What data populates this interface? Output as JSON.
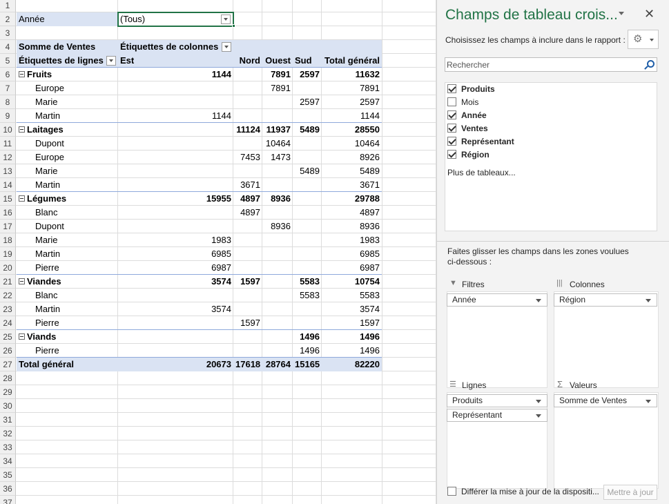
{
  "sheet": {
    "row_numbers": [
      "1",
      "2",
      "3",
      "4",
      "5",
      "6",
      "7",
      "8",
      "9",
      "10",
      "11",
      "12",
      "13",
      "14",
      "15",
      "16",
      "17",
      "18",
      "19",
      "20",
      "21",
      "22",
      "23",
      "24",
      "25",
      "26",
      "27",
      "28",
      "29",
      "30",
      "31",
      "32",
      "33",
      "34",
      "35",
      "36",
      "37"
    ],
    "filter_label": "Année",
    "filter_value": "(Tous)",
    "values_label": "Somme de Ventes",
    "col_labels": "Étiquettes de colonnes",
    "row_labels": "Étiquettes de lignes",
    "col_headers": [
      "Est",
      "Nord",
      "Ouest",
      "Sud",
      "Total général"
    ],
    "rows": [
      {
        "label": "Fruits",
        "level": 0,
        "vals": [
          "1144",
          "",
          "7891",
          "2597",
          "11632"
        ]
      },
      {
        "label": "Europe",
        "level": 1,
        "vals": [
          "",
          "",
          "7891",
          "",
          "7891"
        ]
      },
      {
        "label": "Marie",
        "level": 1,
        "vals": [
          "",
          "",
          "",
          "2597",
          "2597"
        ]
      },
      {
        "label": "Martin",
        "level": 1,
        "vals": [
          "1144",
          "",
          "",
          "",
          "1144"
        ]
      },
      {
        "label": "Laitages",
        "level": 0,
        "vals": [
          "",
          "11124",
          "11937",
          "5489",
          "28550"
        ]
      },
      {
        "label": "Dupont",
        "level": 1,
        "vals": [
          "",
          "",
          "10464",
          "",
          "10464"
        ]
      },
      {
        "label": "Europe",
        "level": 1,
        "vals": [
          "",
          "7453",
          "1473",
          "",
          "8926"
        ]
      },
      {
        "label": "Marie",
        "level": 1,
        "vals": [
          "",
          "",
          "",
          "5489",
          "5489"
        ]
      },
      {
        "label": "Martin",
        "level": 1,
        "vals": [
          "",
          "3671",
          "",
          "",
          "3671"
        ]
      },
      {
        "label": "Légumes",
        "level": 0,
        "vals": [
          "15955",
          "4897",
          "8936",
          "",
          "29788"
        ]
      },
      {
        "label": "Blanc",
        "level": 1,
        "vals": [
          "",
          "4897",
          "",
          "",
          "4897"
        ]
      },
      {
        "label": "Dupont",
        "level": 1,
        "vals": [
          "",
          "",
          "8936",
          "",
          "8936"
        ]
      },
      {
        "label": "Marie",
        "level": 1,
        "vals": [
          "1983",
          "",
          "",
          "",
          "1983"
        ]
      },
      {
        "label": "Martin",
        "level": 1,
        "vals": [
          "6985",
          "",
          "",
          "",
          "6985"
        ]
      },
      {
        "label": "Pierre",
        "level": 1,
        "vals": [
          "6987",
          "",
          "",
          "",
          "6987"
        ]
      },
      {
        "label": "Viandes",
        "level": 0,
        "vals": [
          "3574",
          "1597",
          "",
          "5583",
          "10754"
        ]
      },
      {
        "label": "Blanc",
        "level": 1,
        "vals": [
          "",
          "",
          "",
          "5583",
          "5583"
        ]
      },
      {
        "label": "Martin",
        "level": 1,
        "vals": [
          "3574",
          "",
          "",
          "",
          "3574"
        ]
      },
      {
        "label": "Pierre",
        "level": 1,
        "vals": [
          "",
          "1597",
          "",
          "",
          "1597"
        ]
      },
      {
        "label": "Viands",
        "level": 0,
        "vals": [
          "",
          "",
          "",
          "1496",
          "1496"
        ]
      },
      {
        "label": "Pierre",
        "level": 1,
        "vals": [
          "",
          "",
          "",
          "1496",
          "1496"
        ]
      }
    ],
    "grand_total": {
      "label": "Total général",
      "vals": [
        "20673",
        "17618",
        "28764",
        "15165",
        "82220"
      ]
    }
  },
  "pane": {
    "title": "Champs de tableau crois...",
    "choose_text": "Choisissez les champs à inclure dans le rapport :",
    "gear_icon": "gear-icon",
    "search_placeholder": "Rechercher",
    "fields": [
      {
        "label": "Produits",
        "checked": true
      },
      {
        "label": "Mois",
        "checked": false
      },
      {
        "label": "Année",
        "checked": true
      },
      {
        "label": "Ventes",
        "checked": true
      },
      {
        "label": "Représentant",
        "checked": true
      },
      {
        "label": "Région",
        "checked": true
      }
    ],
    "more_tables": "Plus de tableaux...",
    "drag_text_1": "Faites glisser les champs dans les zones voulues",
    "drag_text_2": "ci-dessous :",
    "areas": {
      "filters": {
        "title": "Filtres",
        "items": [
          "Année"
        ]
      },
      "columns": {
        "title": "Colonnes",
        "items": [
          "Région"
        ]
      },
      "rows": {
        "title": "Lignes",
        "items": [
          "Produits",
          "Représentant"
        ]
      },
      "values": {
        "title": "Valeurs",
        "items": [
          "Somme de Ventes"
        ]
      }
    },
    "defer_label": "Différer la mise à jour de la dispositi...",
    "update_button": "Mettre à jour",
    "accent_color": "#217346"
  }
}
